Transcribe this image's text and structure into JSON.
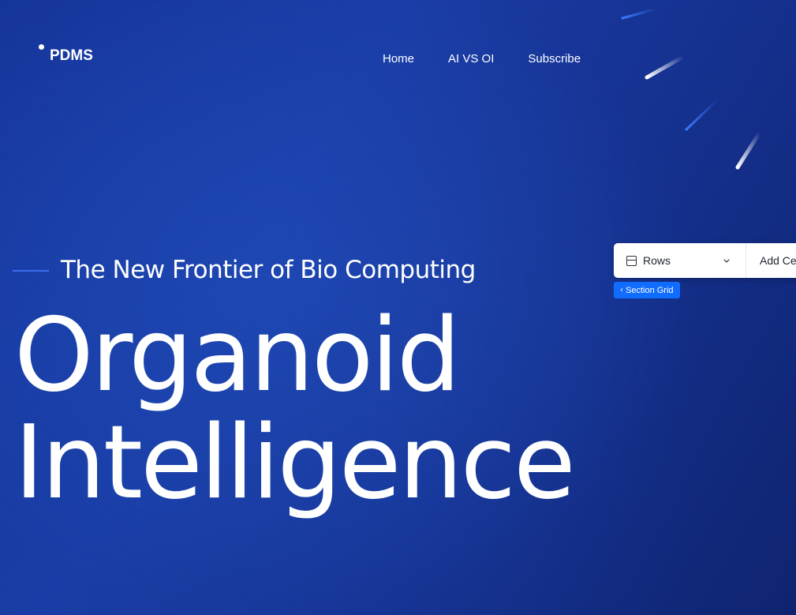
{
  "colors": {
    "background": "#1a3ca6",
    "accent": "#3b6cf0",
    "editor_blue": "#116dff"
  },
  "logo": {
    "text": "PDMS"
  },
  "nav": {
    "items": [
      {
        "label": "Home"
      },
      {
        "label": "AI VS OI"
      },
      {
        "label": "Subscribe"
      }
    ]
  },
  "hero": {
    "subtitle": "The New Frontier of Bio Computing",
    "title_line1": "Organoid",
    "title_line2": "Intelligence"
  },
  "editor": {
    "rows_label": "Rows",
    "rows_icon": "rows-layout-icon",
    "add_label": "Add Ce",
    "section_badge": "Section Grid"
  }
}
